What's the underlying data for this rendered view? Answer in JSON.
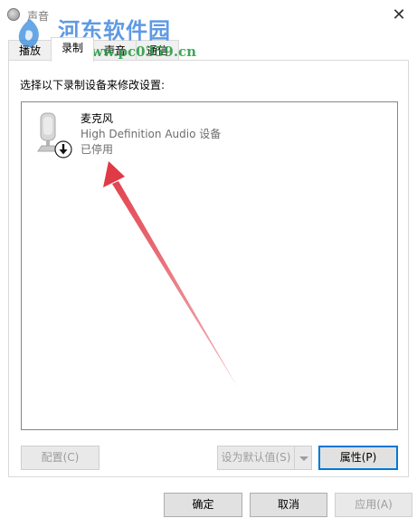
{
  "window": {
    "title": "声音",
    "close_glyph": "✕"
  },
  "watermark": {
    "name": "河东软件园",
    "url": "www.pc0359.cn"
  },
  "tabs": [
    {
      "label": "播放"
    },
    {
      "label": "录制"
    },
    {
      "label": "声音"
    },
    {
      "label": "通信"
    }
  ],
  "instruction": "选择以下录制设备来修改设置:",
  "devices": [
    {
      "name": "麦克风",
      "description": "High Definition Audio 设备",
      "status": "已停用",
      "icon": "microphone-icon",
      "badge": "disabled-down-arrow-icon"
    }
  ],
  "buttons": {
    "configure": "配置(C)",
    "set_default": "设为默认值(S)",
    "properties": "属性(P)",
    "ok": "确定",
    "cancel": "取消",
    "apply": "应用(A)"
  },
  "annotation": {
    "color": "#e03a46"
  }
}
